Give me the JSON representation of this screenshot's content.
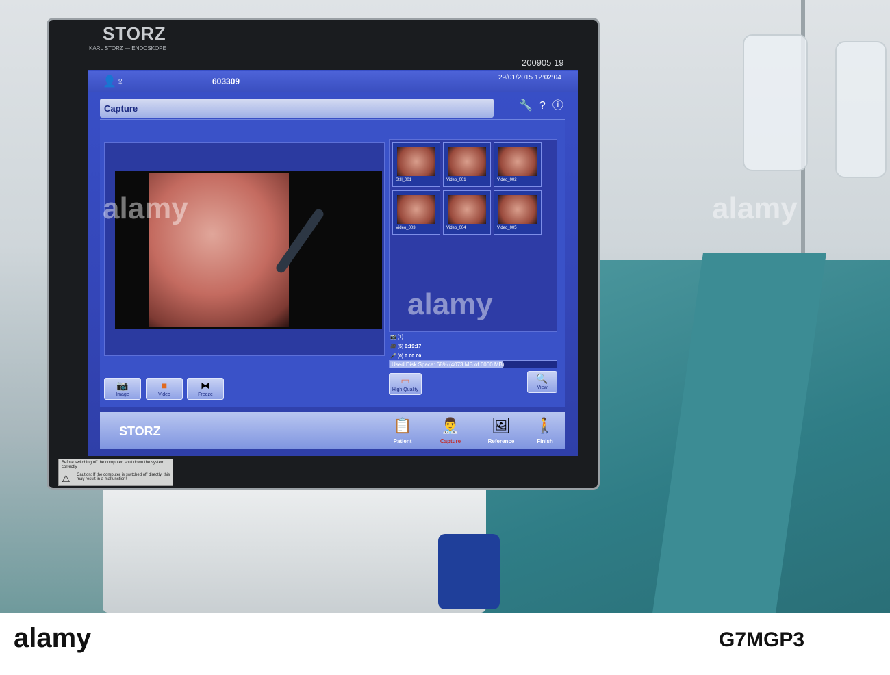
{
  "monitor": {
    "brand": "STORZ",
    "brand_sub": "KARL STORZ — ENDOSKOPE",
    "serial": "200905 19"
  },
  "topbar": {
    "patient_id": "603309",
    "datetime": "29/01/2015 12:02:04"
  },
  "capture": {
    "title": "Capture"
  },
  "thumbnails": [
    {
      "label": "Still_001",
      "type": "still"
    },
    {
      "label": "Video_001",
      "type": "video"
    },
    {
      "label": "Video_002",
      "type": "video"
    },
    {
      "label": "Video_003",
      "type": "video"
    },
    {
      "label": "Video_004",
      "type": "video"
    },
    {
      "label": "Video_005",
      "type": "video"
    }
  ],
  "stats": {
    "stills": "(1)",
    "videos": "(5) 0:19:17",
    "audio": "(0) 0:00:00"
  },
  "disk": {
    "text": "Used Disk Space: 68% (4073 MB of 6000 MB)",
    "percent": 68
  },
  "buttons": {
    "image": "Image",
    "video": "Video",
    "freeze": "Freeze",
    "high_quality": "High Quality",
    "view": "View"
  },
  "nav": {
    "logo": "STORZ",
    "patient": "Patient",
    "capture": "Capture",
    "reference": "Reference",
    "finish": "Finish"
  },
  "sticker": {
    "line1": "Before switching off the computer, shut down the system correctly",
    "caution": "Caution: If the computer is switched off directly, this may result in a malfunction!"
  },
  "watermark": {
    "text": "alamy",
    "footer_logo": "alamy",
    "image_id": "G7MGP3"
  }
}
